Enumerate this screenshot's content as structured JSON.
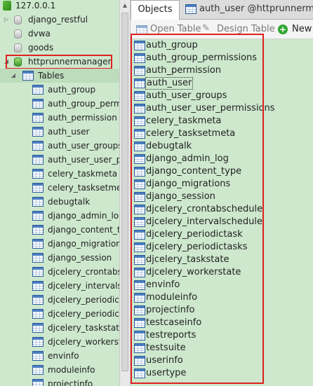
{
  "navigator": {
    "server": "127.0.0.1",
    "databases": [
      {
        "name": "django_restful",
        "icon": "database-icon"
      },
      {
        "name": "dvwa",
        "icon": "database-icon"
      },
      {
        "name": "goods",
        "icon": "database-icon"
      },
      {
        "name": "httprunnermanager",
        "icon": "database-icon-open",
        "expanded": true,
        "highlighted": true
      }
    ],
    "tables_label": "Tables",
    "tables": [
      "auth_group",
      "auth_group_perm",
      "auth_permission",
      "auth_user",
      "auth_user_groups",
      "auth_user_user_pe",
      "celery_taskmeta",
      "celery_tasksetmet",
      "debugtalk",
      "django_admin_log",
      "django_content_ty",
      "django_migration",
      "django_session",
      "djcelery_crontabs",
      "djcelery_intervalsc",
      "djcelery_periodict",
      "djcelery_periodict",
      "djcelery_taskstate",
      "djcelery_workerst",
      "envinfo",
      "moduleinfo",
      "projectinfo"
    ]
  },
  "tabs": [
    {
      "label": "Objects",
      "active": true
    },
    {
      "label": "auth_user @httprunnerman...",
      "active": false
    }
  ],
  "toolbar": {
    "open_table": "Open Table",
    "design_table": "Design Table",
    "new": "New"
  },
  "objects": [
    "auth_group",
    "auth_group_permissions",
    "auth_permission",
    "auth_user",
    "auth_user_groups",
    "auth_user_user_permissions",
    "celery_taskmeta",
    "celery_tasksetmeta",
    "debugtalk",
    "django_admin_log",
    "django_content_type",
    "django_migrations",
    "django_session",
    "djcelery_crontabschedule",
    "djcelery_intervalschedule",
    "djcelery_periodictask",
    "djcelery_periodictasks",
    "djcelery_taskstate",
    "djcelery_workerstate",
    "envinfo",
    "moduleinfo",
    "projectinfo",
    "testcaseinfo",
    "testreports",
    "testsuite",
    "userinfo",
    "usertype"
  ],
  "selected_object": "auth_user",
  "colors": {
    "pane_background": "#cde8cd",
    "highlight_red": "#e02020",
    "table_icon_blue": "#4a7ec2"
  }
}
